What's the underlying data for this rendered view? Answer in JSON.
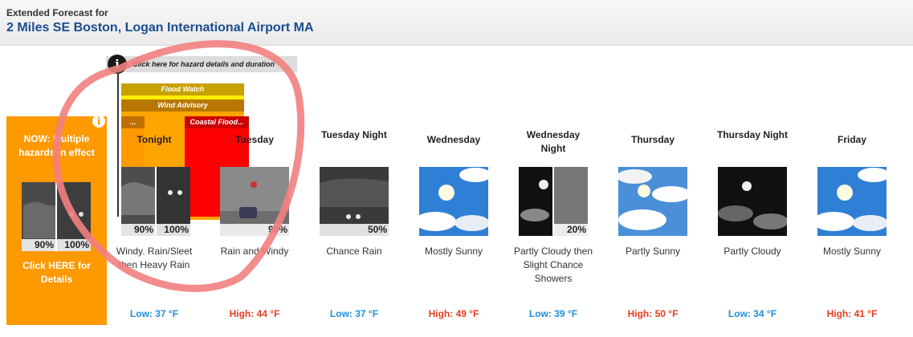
{
  "header": {
    "label": "Extended Forecast for",
    "location": "2 Miles SE Boston, Logan International Airport MA"
  },
  "now_panel": {
    "info": "i",
    "text": "NOW: Multiple hazards in effect",
    "pct_left": "90%",
    "pct_right": "100%",
    "click": "Click HERE for Details"
  },
  "hazard_bar": {
    "info": "i",
    "text": "Click here for hazard details and duration"
  },
  "hazards": [
    {
      "name": "Flood Watch",
      "color": "#c8a000"
    },
    {
      "name": "Wind Advisory",
      "color": "#b87800"
    },
    {
      "name": "...",
      "color": "#c07000"
    },
    {
      "name": "Coastal Flood...",
      "color": "#cc0000"
    }
  ],
  "periods": [
    {
      "name": "Tonight",
      "short": "Windy. Rain/Sleet then Heavy Rain",
      "temp": "Low: 37 °F",
      "kind": "low",
      "pct": "90%",
      "pct2": "100%"
    },
    {
      "name": "Tuesday",
      "short": "Rain and Windy",
      "temp": "High: 44 °F",
      "kind": "high",
      "pct": "90%"
    },
    {
      "name": "Tuesday Night",
      "short": "Chance Rain",
      "temp": "Low: 37 °F",
      "kind": "low",
      "pct": "50%"
    },
    {
      "name": "Wednesday",
      "short": "Mostly Sunny",
      "temp": "High: 49 °F",
      "kind": "high"
    },
    {
      "name": "Wednesday Night",
      "short": "Partly Cloudy then Slight Chance Showers",
      "temp": "Low: 39 °F",
      "kind": "low",
      "pct": "20%"
    },
    {
      "name": "Thursday",
      "short": "Partly Sunny",
      "temp": "High: 50 °F",
      "kind": "high"
    },
    {
      "name": "Thursday Night",
      "short": "Partly Cloudy",
      "temp": "Low: 34 °F",
      "kind": "low"
    },
    {
      "name": "Friday",
      "short": "Mostly Sunny",
      "temp": "High: 41 °F",
      "kind": "high"
    }
  ],
  "icons": [
    "rain-night-icon",
    "rain-day-icon",
    "rain-night-icon",
    "mostly-sunny-icon",
    "partly-cloudy-night-showers-icon",
    "partly-sunny-icon",
    "partly-cloudy-night-icon",
    "mostly-sunny-icon"
  ],
  "colors": {
    "now_panel": "#ff9900",
    "low_temp": "#1f8fd6",
    "high_temp": "#e53d1e",
    "annotation_circle": "#f28080"
  }
}
